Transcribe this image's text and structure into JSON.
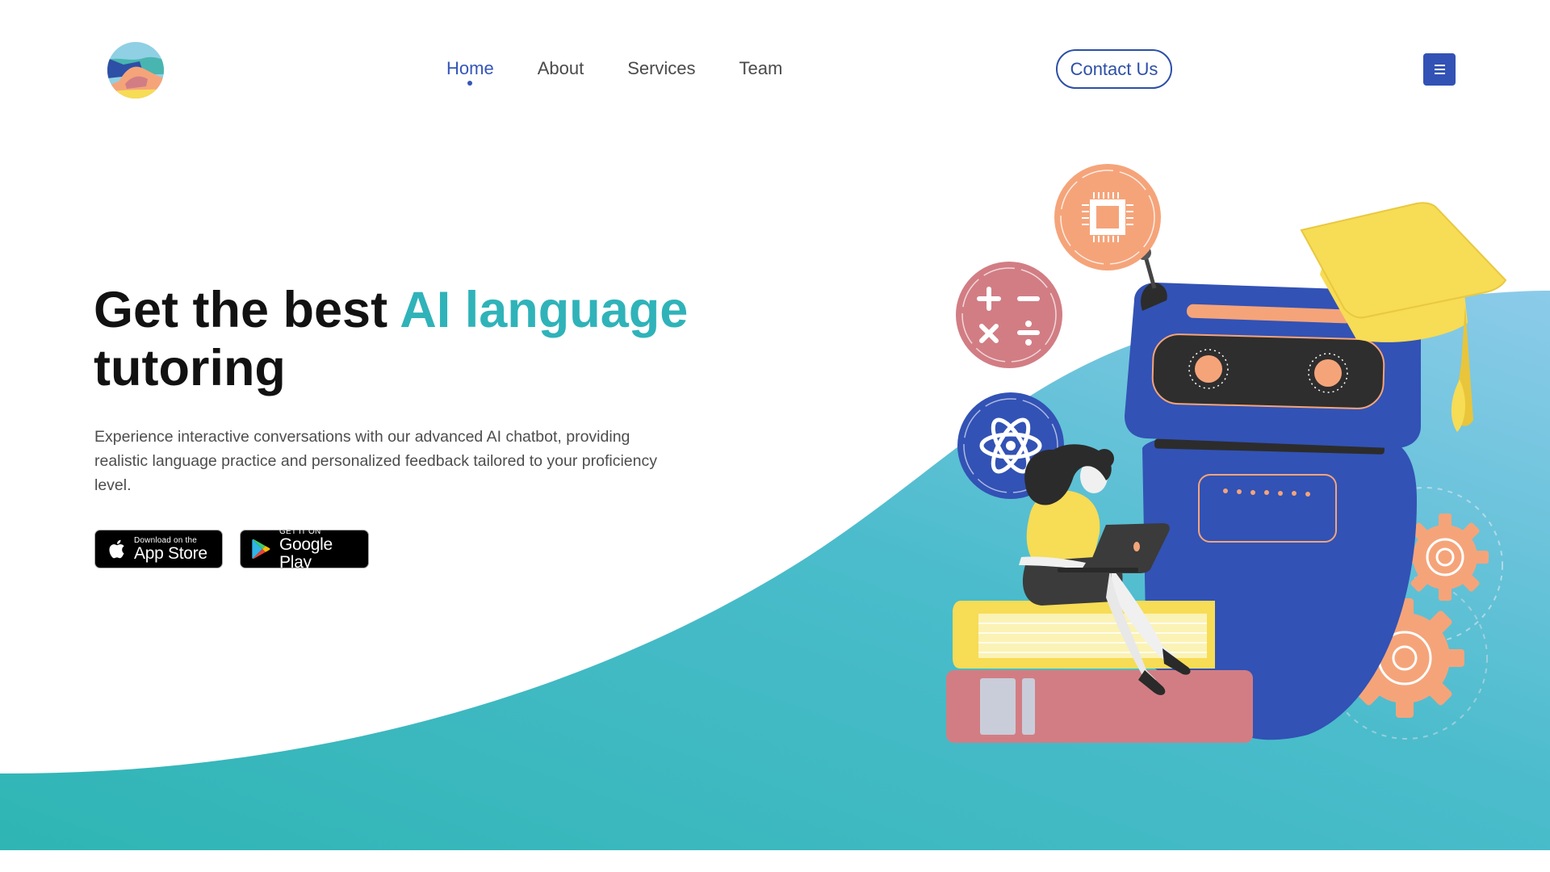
{
  "nav": {
    "items": [
      {
        "label": "Home",
        "active": true
      },
      {
        "label": "About",
        "active": false
      },
      {
        "label": "Services",
        "active": false
      },
      {
        "label": "Team",
        "active": false
      }
    ],
    "contact_label": "Contact Us"
  },
  "hero": {
    "title_part1": "Get the best ",
    "title_accent": "AI language",
    "title_part2": "tutoring",
    "description": "Experience interactive conversations with our advanced AI chatbot, providing realistic language practice and personalized feedback tailored to your proficiency level."
  },
  "badges": {
    "apple": {
      "small": "Download on the",
      "big": "App Store"
    },
    "google": {
      "small": "GET IT ON",
      "big": "Google Play"
    }
  },
  "colors": {
    "primary": "#3252b5",
    "accent": "#2fb3b9",
    "wave_start": "#2fb5b4",
    "wave_end": "#8ccbea",
    "orange": "#f5a47a",
    "yellow": "#f7dc55",
    "pink": "#d27d84"
  },
  "icons": {
    "logo": "mountain-landscape-logo",
    "menu": "hamburger-menu-icon",
    "apple": "apple-icon",
    "google": "google-play-icon",
    "chip": "microchip-icon",
    "math": "math-operators-icon",
    "atom": "atom-icon",
    "gear": "gear-icon"
  }
}
